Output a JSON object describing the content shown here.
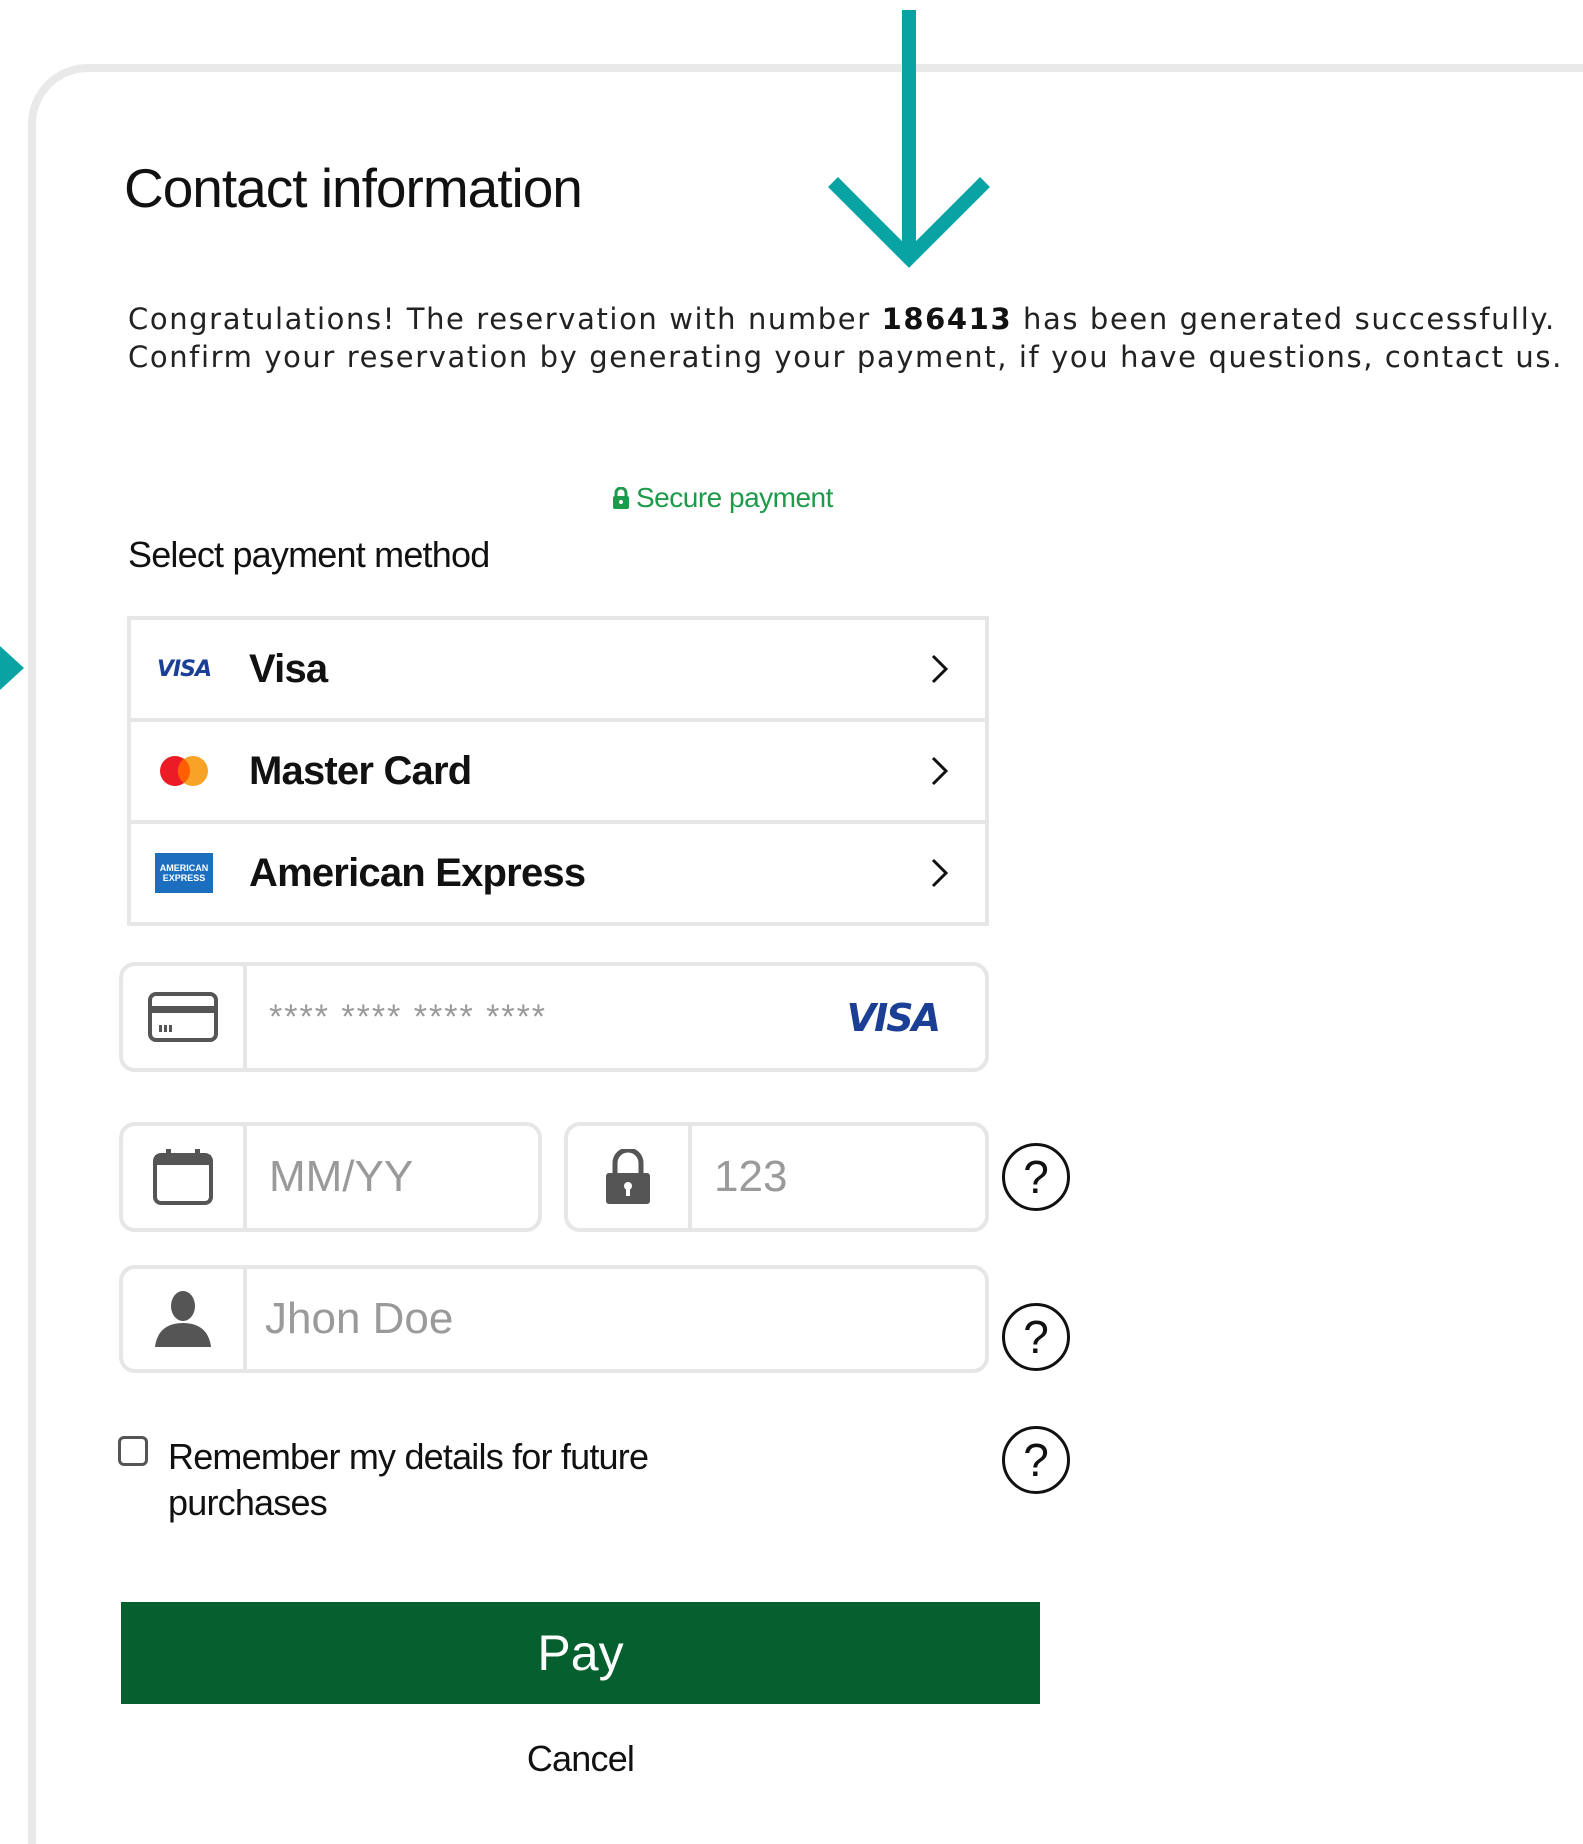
{
  "contact": {
    "title": "Contact information",
    "message_part1": "Congratulations! The reservation with number ",
    "reservation_number": "186413",
    "message_part2": " has been generated successfully.",
    "message_line2": "Confirm your reservation by generating your payment, if you have questions, contact us."
  },
  "payment": {
    "secure_label": "Secure payment",
    "select_label": "Select payment method",
    "methods": [
      {
        "label": "Visa",
        "logo_text": "VISA",
        "icon": "visa-logo-icon"
      },
      {
        "label": "Master Card",
        "icon": "mastercard-logo-icon"
      },
      {
        "label": "American Express",
        "logo_text_top": "AMERICAN",
        "logo_text_bottom": "EXPRESS",
        "icon": "amex-logo-icon"
      }
    ],
    "card_number": {
      "value": "",
      "placeholder": "**** **** **** ****",
      "brand": "VISA",
      "icon": "credit-card-icon"
    },
    "expiry": {
      "value": "",
      "placeholder": "MM/YY",
      "icon": "calendar-icon"
    },
    "cvv": {
      "value": "",
      "placeholder": "123",
      "icon": "lock-icon"
    },
    "name": {
      "value": "",
      "placeholder": "Jhon Doe",
      "icon": "user-icon"
    },
    "help_symbol": "?",
    "remember_label": "Remember my details for future purchases",
    "remember_checked": false,
    "pay_label": "Pay",
    "cancel_label": "Cancel"
  },
  "colors": {
    "accent_teal": "#0aa3a3",
    "secure_green": "#1e9b4a",
    "pay_green": "#055f2f",
    "visa_blue": "#1a3f95",
    "mastercard_red": "#eb1c26",
    "mastercard_orange": "#f79e1b",
    "amex_blue": "#1c6fbf",
    "border_gray": "#e6e6e6"
  }
}
